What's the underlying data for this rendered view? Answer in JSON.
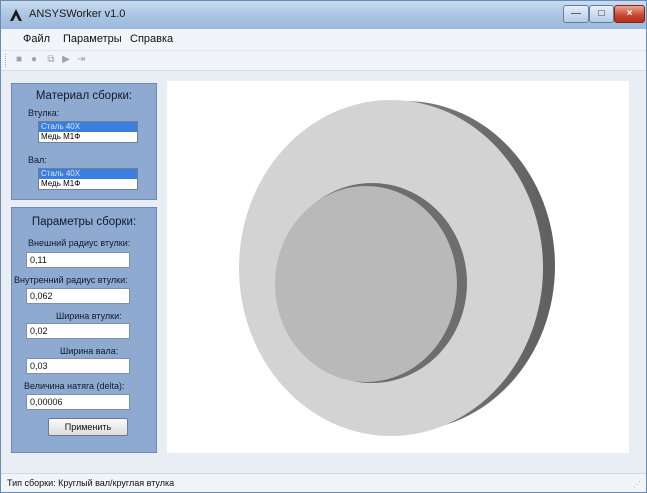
{
  "window": {
    "title": "ANSYSWorker v1.0",
    "min_label": "—",
    "max_label": "□",
    "close_label": "×"
  },
  "menu": {
    "items": [
      "Файл",
      "Параметры",
      "Справка"
    ]
  },
  "toolbar": {
    "icons": [
      "stop-icon",
      "record-icon",
      "copy-icon",
      "play-icon",
      "step-icon"
    ]
  },
  "material_panel": {
    "title": "Материал сборки:",
    "bushing_label": "Втулка:",
    "bushing_options": [
      "Сталь 40Х",
      "Медь М1Ф"
    ],
    "bushing_selected": "Сталь 40Х",
    "shaft_label": "Вал:",
    "shaft_options": [
      "Сталь 40Х",
      "Медь М1Ф"
    ],
    "shaft_selected": "Сталь 40Х"
  },
  "params_panel": {
    "title": "Параметры сборки:",
    "outer_radius_label": "Внешний радиус втулки:",
    "outer_radius_value": "0,11",
    "inner_radius_label": "Внутренний радиус втулки:",
    "inner_radius_value": "0,062",
    "bushing_width_label": "Ширина втулки:",
    "bushing_width_value": "0,02",
    "shaft_width_label": "Ширина вала:",
    "shaft_width_value": "0,03",
    "interference_label": "Величина натяга (delta):",
    "interference_value": "0,00006",
    "apply_label": "Применить"
  },
  "statusbar": {
    "text": "Тип сборки: Круглый вал/круглая втулка"
  },
  "colors": {
    "panel_bg": "#8faad0",
    "selection": "#3b7ee0",
    "close_button": "#c9432b"
  }
}
